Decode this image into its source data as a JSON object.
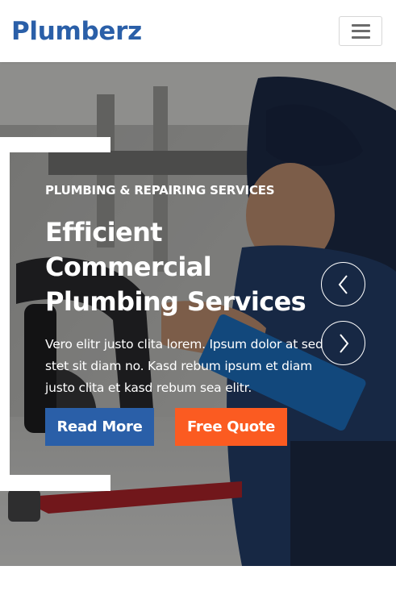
{
  "navbar": {
    "brand": "Plumberz",
    "menu_icon": "hamburger-menu-icon"
  },
  "hero": {
    "eyebrow": "PLUMBING & REPAIRING SERVICES",
    "headline_line1": "Efficient Commercial",
    "headline_line2": "Plumbing Services",
    "lead": "Vero elitr justo clita lorem. Ipsum dolor at sed stet sit diam no. Kasd rebum ipsum et diam justo clita et kasd rebum sea elitr.",
    "primary_button": "Read More",
    "secondary_button": "Free Quote",
    "prev_icon": "chevron-left-icon",
    "next_icon": "chevron-right-icon"
  },
  "colors": {
    "brand_blue": "#2a5fa8",
    "accent_orange": "#fb5b21"
  }
}
